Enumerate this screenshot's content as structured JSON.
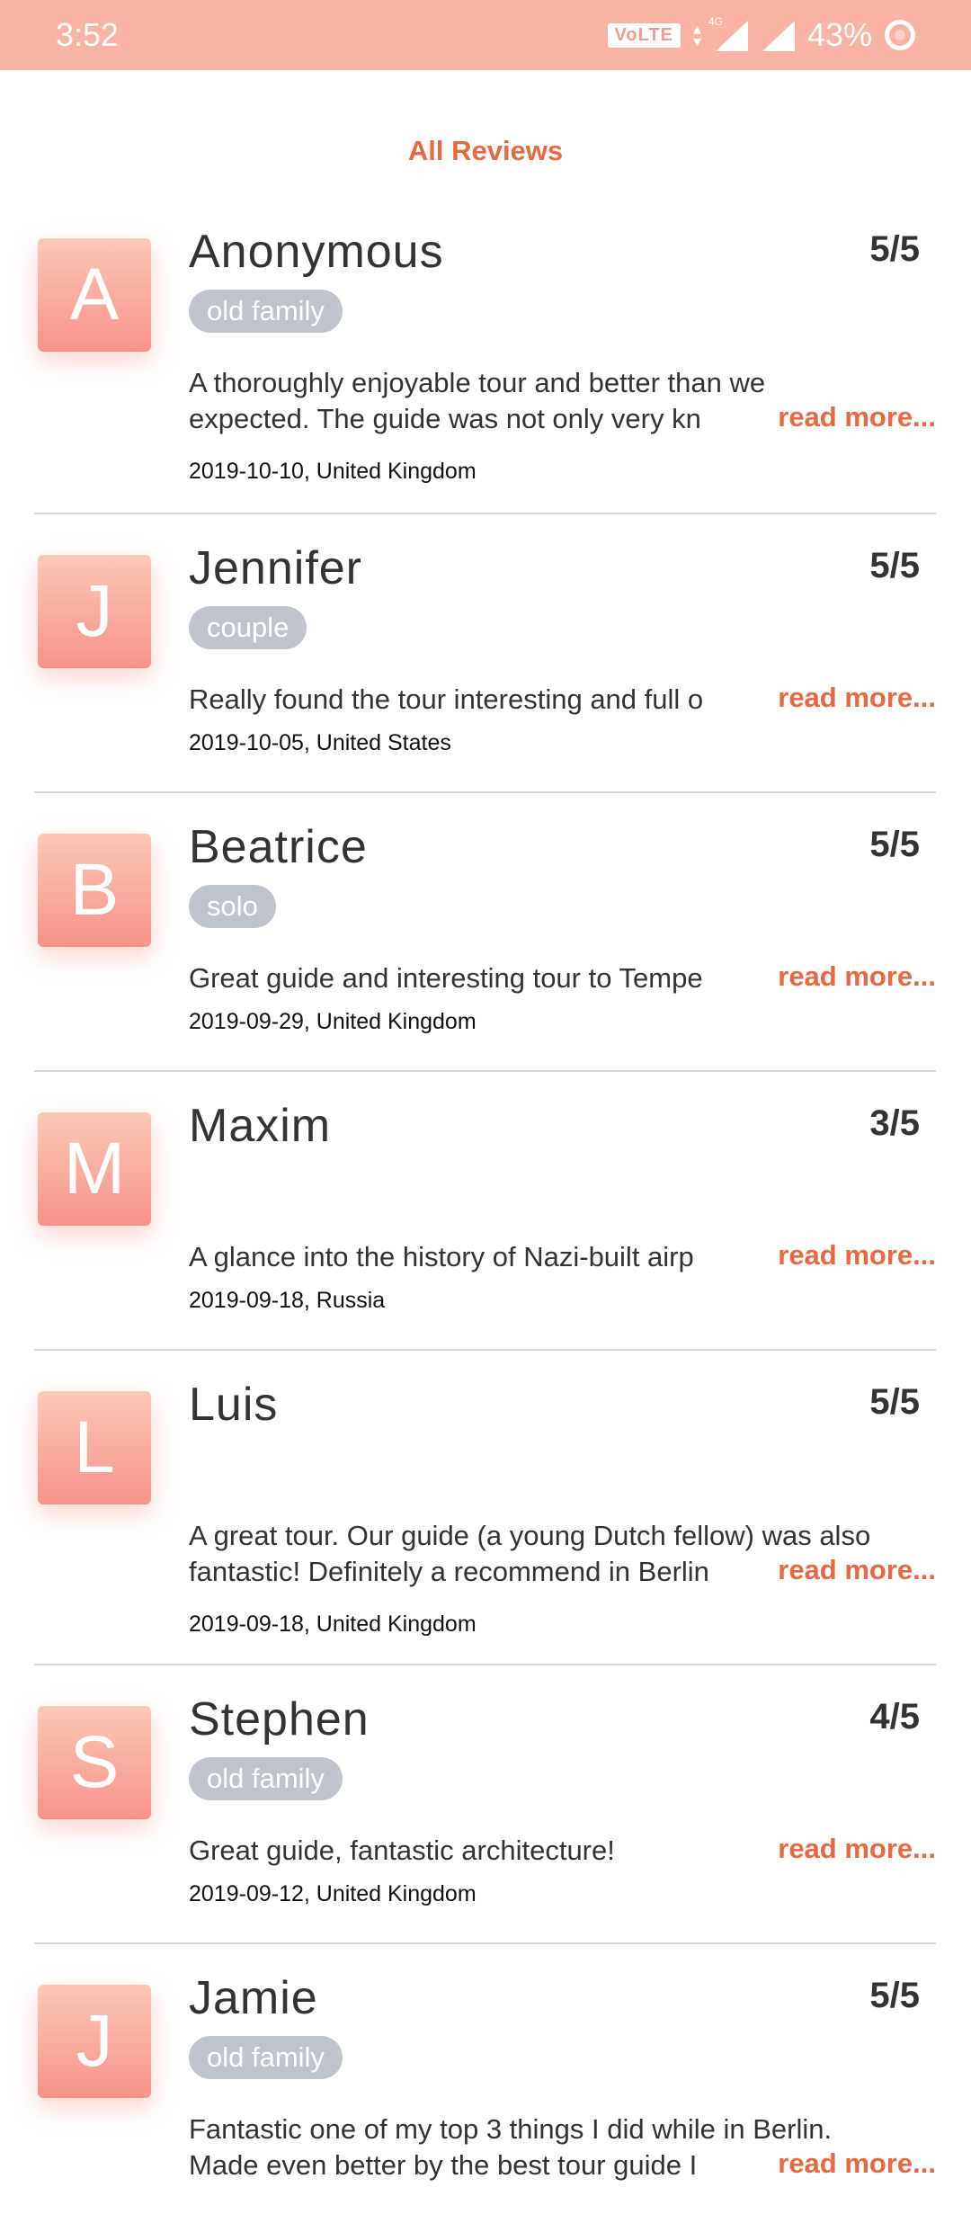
{
  "status_bar": {
    "time": "3:52",
    "volte": "VoLTE",
    "network": "4G",
    "battery": "43%"
  },
  "page": {
    "title": "All Reviews"
  },
  "colors": {
    "accent": "#e8683f",
    "status_bar": "#f9b3a4",
    "tag": "#bfc3cc",
    "avatar_top": "#fbc8b8",
    "avatar_bottom": "#f7928a"
  },
  "read_more_label": "read more...",
  "reviews": [
    {
      "initial": "A",
      "name": "Anonymous",
      "rating": "5/5",
      "tag": "old family",
      "lines": [
        "A thoroughly enjoyable tour and better than we",
        "expected. The guide was not only very kn"
      ],
      "meta": "2019-10-10, United Kingdom"
    },
    {
      "initial": "J",
      "name": "Jennifer",
      "rating": "5/5",
      "tag": "couple",
      "lines": [
        "Really found the tour interesting and full o"
      ],
      "meta": "2019-10-05, United States"
    },
    {
      "initial": "B",
      "name": "Beatrice",
      "rating": "5/5",
      "tag": "solo",
      "lines": [
        "Great guide and interesting tour to Tempe"
      ],
      "meta": "2019-09-29, United Kingdom"
    },
    {
      "initial": "M",
      "name": "Maxim",
      "rating": "3/5",
      "tag": "",
      "lines": [
        "A glance into the history of Nazi-built airp"
      ],
      "meta": "2019-09-18, Russia"
    },
    {
      "initial": "L",
      "name": "Luis",
      "rating": "5/5",
      "tag": "",
      "lines": [
        "A great tour. Our guide (a young Dutch fellow) was also",
        "fantastic! Definitely a recommend in Berlin"
      ],
      "meta": "2019-09-18, United Kingdom"
    },
    {
      "initial": "S",
      "name": "Stephen",
      "rating": "4/5",
      "tag": "old family",
      "lines": [
        "Great guide, fantastic architecture!"
      ],
      "meta": "2019-09-12, United Kingdom"
    },
    {
      "initial": "J",
      "name": "Jamie",
      "rating": "5/5",
      "tag": "old family",
      "lines": [
        "Fantastic one of my top 3 things I did while in Berlin.",
        "Made even better by the best tour guide I"
      ],
      "meta": ""
    }
  ]
}
